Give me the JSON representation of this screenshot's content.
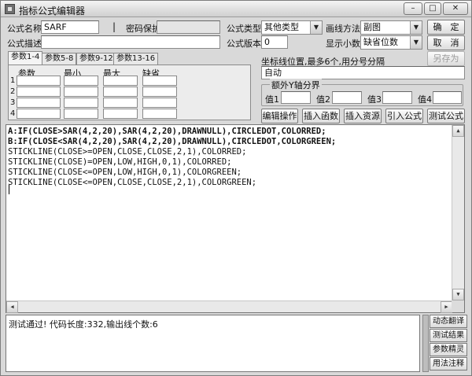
{
  "window": {
    "title": "指标公式编辑器",
    "controls": {
      "minimize": "–",
      "maximize": "□",
      "close": "✕"
    }
  },
  "form": {
    "name_label": "公式名称",
    "name_value": "SARF",
    "password_label": "密码保护",
    "password_value": "",
    "type_label": "公式类型",
    "type_value": "其他类型",
    "draw_label": "画线方法",
    "draw_value": "副图",
    "desc_label": "公式描述",
    "desc_value": "",
    "version_label": "公式版本",
    "version_value": "0",
    "decimal_label": "显示小数",
    "decimal_value": "缺省位数"
  },
  "buttons": {
    "ok": "确　定",
    "cancel": "取　消",
    "save_as": "另存为",
    "edit_op": "编辑操作",
    "insert_func": "插入函数",
    "insert_res": "插入资源",
    "import_formula": "引入公式",
    "test_formula": "测试公式"
  },
  "tabs": [
    "参数1-4",
    "参数5-8",
    "参数9-12",
    "参数13-16"
  ],
  "params": {
    "headers": [
      "参数",
      "最小",
      "最大",
      "缺省"
    ],
    "rows": [
      "1",
      "2",
      "3",
      "4"
    ]
  },
  "coord": {
    "label": "坐标线位置,最多6个,用分号分隔",
    "value": "自动"
  },
  "yaxis": {
    "title": "额外Y轴分界",
    "labels": [
      "值1",
      "值2",
      "值3",
      "值4"
    ]
  },
  "code": [
    "A:IF(CLOSE>SAR(4,2,20),SAR(4,2,20),DRAWNULL),CIRCLEDOT,COLORRED;",
    "B:IF(CLOSE<SAR(4,2,20),SAR(4,2,20),DRAWNULL),CIRCLEDOT,COLORGREEN;",
    "STICKLINE(CLOSE>=OPEN,CLOSE,CLOSE,2,1),COLORRED;",
    "STICKLINE(CLOSE)=OPEN,LOW,HIGH,0,1),COLORRED;",
    "STICKLINE(CLOSE<=OPEN,LOW,HIGH,0,1),COLORGREEN;",
    "STICKLINE(CLOSE<=OPEN,CLOSE,CLOSE,2,1),COLORGREEN;"
  ],
  "status": {
    "message": "测试通过! 代码长度:332,输出线个数:6"
  },
  "side_buttons": [
    "动态翻译",
    "测试结果",
    "参数精灵",
    "用法注释"
  ],
  "colors": {
    "window_bg": "#d9d9d9",
    "field_bg": "#ffffff"
  }
}
